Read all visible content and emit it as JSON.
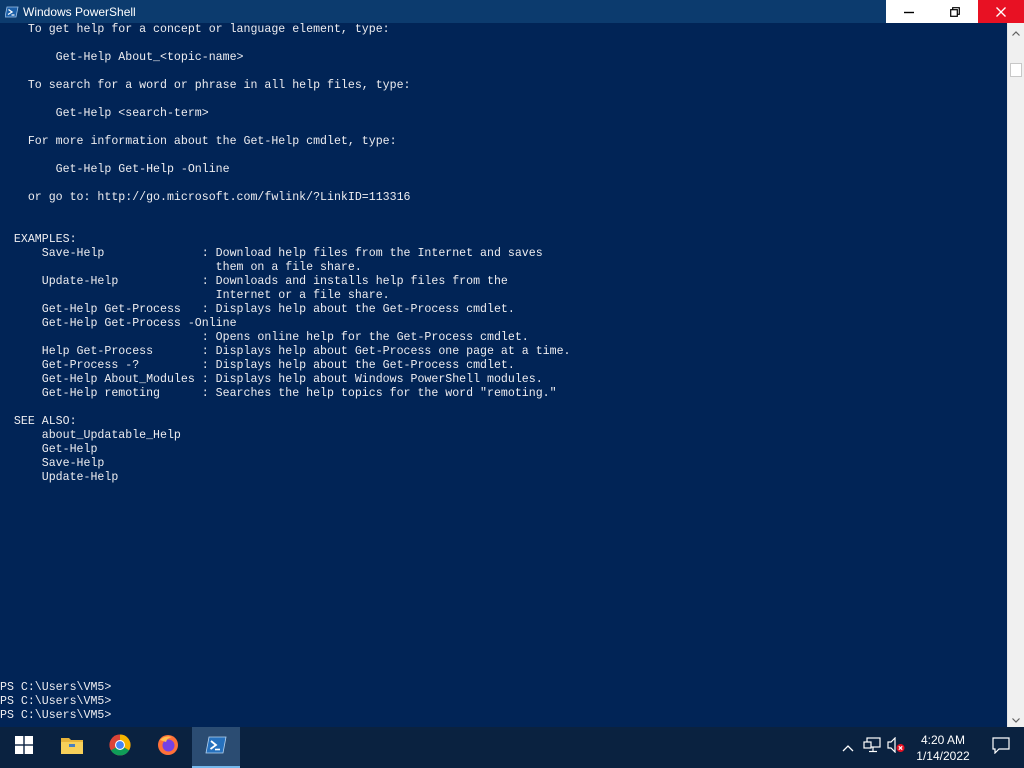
{
  "window": {
    "title": "Windows PowerShell",
    "icon": "powershell-icon",
    "controls": [
      "minimize-icon",
      "restore-icon",
      "close-icon"
    ]
  },
  "console": {
    "lines": [
      "    To get help for a concept or language element, type:",
      "",
      "        Get-Help About_<topic-name>",
      "",
      "    To search for a word or phrase in all help files, type:",
      "",
      "        Get-Help <search-term>",
      "",
      "    For more information about the Get-Help cmdlet, type:",
      "",
      "        Get-Help Get-Help -Online",
      "",
      "    or go to: http://go.microsoft.com/fwlink/?LinkID=113316",
      "",
      "",
      "  EXAMPLES:",
      "      Save-Help              : Download help files from the Internet and saves",
      "                               them on a file share.",
      "      Update-Help            : Downloads and installs help files from the",
      "                               Internet or a file share.",
      "      Get-Help Get-Process   : Displays help about the Get-Process cmdlet.",
      "      Get-Help Get-Process -Online",
      "                             : Opens online help for the Get-Process cmdlet.",
      "      Help Get-Process       : Displays help about Get-Process one page at a time.",
      "      Get-Process -?         : Displays help about the Get-Process cmdlet.",
      "      Get-Help About_Modules : Displays help about Windows PowerShell modules.",
      "      Get-Help remoting      : Searches the help topics for the word \"remoting.\"",
      "",
      "  SEE ALSO:",
      "      about_Updatable_Help",
      "      Get-Help",
      "      Save-Help",
      "      Update-Help"
    ],
    "prompts": [
      "PS C:\\Users\\VM5>",
      "PS C:\\Users\\VM5>",
      "PS C:\\Users\\VM5>"
    ]
  },
  "colors": {
    "console_bg": "#012456",
    "console_fg": "#eeedf0",
    "taskbar_bg": "#0a2240",
    "close_red": "#e81123"
  },
  "taskbar": {
    "items": [
      {
        "name": "start-button",
        "icon": "windows-logo-icon"
      },
      {
        "name": "file-explorer-button",
        "icon": "folder-icon"
      },
      {
        "name": "chrome-button",
        "icon": "chrome-icon"
      },
      {
        "name": "firefox-button",
        "icon": "firefox-icon"
      },
      {
        "name": "powershell-taskbar-button",
        "icon": "powershell-icon",
        "active": true
      }
    ],
    "tray": {
      "icons": [
        "chevron-up-icon",
        "network-icon",
        "volume-muted-icon"
      ],
      "time": "4:20 AM",
      "date": "1/14/2022",
      "notification_icon": "action-center-icon"
    }
  }
}
